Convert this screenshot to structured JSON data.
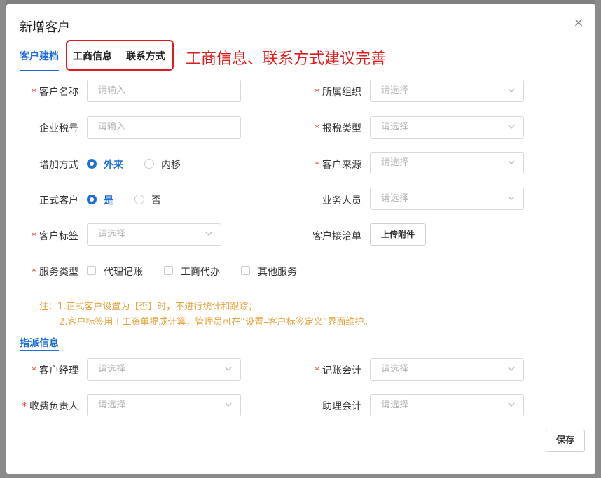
{
  "dialog": {
    "title": "新增客户",
    "close_icon": "×"
  },
  "tabs": [
    {
      "label": "客户建档",
      "active": true
    },
    {
      "label": "工商信息",
      "active": false
    },
    {
      "label": "联系方式",
      "active": false
    }
  ],
  "annotation": "工商信息、联系方式建议完善",
  "form": {
    "customer_name": {
      "label": "客户名称",
      "required": "*",
      "placeholder": "请输入"
    },
    "org": {
      "label": "所属组织",
      "required": "*",
      "placeholder": "请选择"
    },
    "tax_no": {
      "label": "企业税号",
      "placeholder": "请输入"
    },
    "tax_type": {
      "label": "报税类型",
      "required": "*",
      "placeholder": "请选择"
    },
    "add_method": {
      "label": "增加方式",
      "options": [
        "外来",
        "内移"
      ]
    },
    "source": {
      "label": "客户来源",
      "required": "*",
      "placeholder": "请选择"
    },
    "formal": {
      "label": "正式客户",
      "options": [
        "是",
        "否"
      ]
    },
    "salesperson": {
      "label": "业务人员",
      "placeholder": "请选择"
    },
    "tags": {
      "label": "客户标签",
      "required": "*",
      "placeholder": "请选择"
    },
    "contract": {
      "label": "客户接洽单",
      "button": "上传附件"
    },
    "service_type": {
      "label": "服务类型",
      "required": "*",
      "options": [
        "代理记账",
        "工商代办",
        "其他服务"
      ]
    }
  },
  "notes": {
    "line1": "注：1.正式客户设置为【否】时，不进行统计和跟踪；",
    "line2": "2.客户标签用于工资单提成计算，管理员可在“设置–客户标签定义”界面维护。"
  },
  "assign_section": {
    "title": "指派信息",
    "manager": {
      "label": "客户经理",
      "required": "*",
      "placeholder": "请选择"
    },
    "accountant": {
      "label": "记账会计",
      "required": "*",
      "placeholder": "请选择"
    },
    "fee_owner": {
      "label": "收费负责人",
      "required": "*",
      "placeholder": "请选择"
    },
    "assistant": {
      "label": "助理会计",
      "placeholder": "请选择"
    }
  },
  "actions": {
    "save": "保存"
  }
}
